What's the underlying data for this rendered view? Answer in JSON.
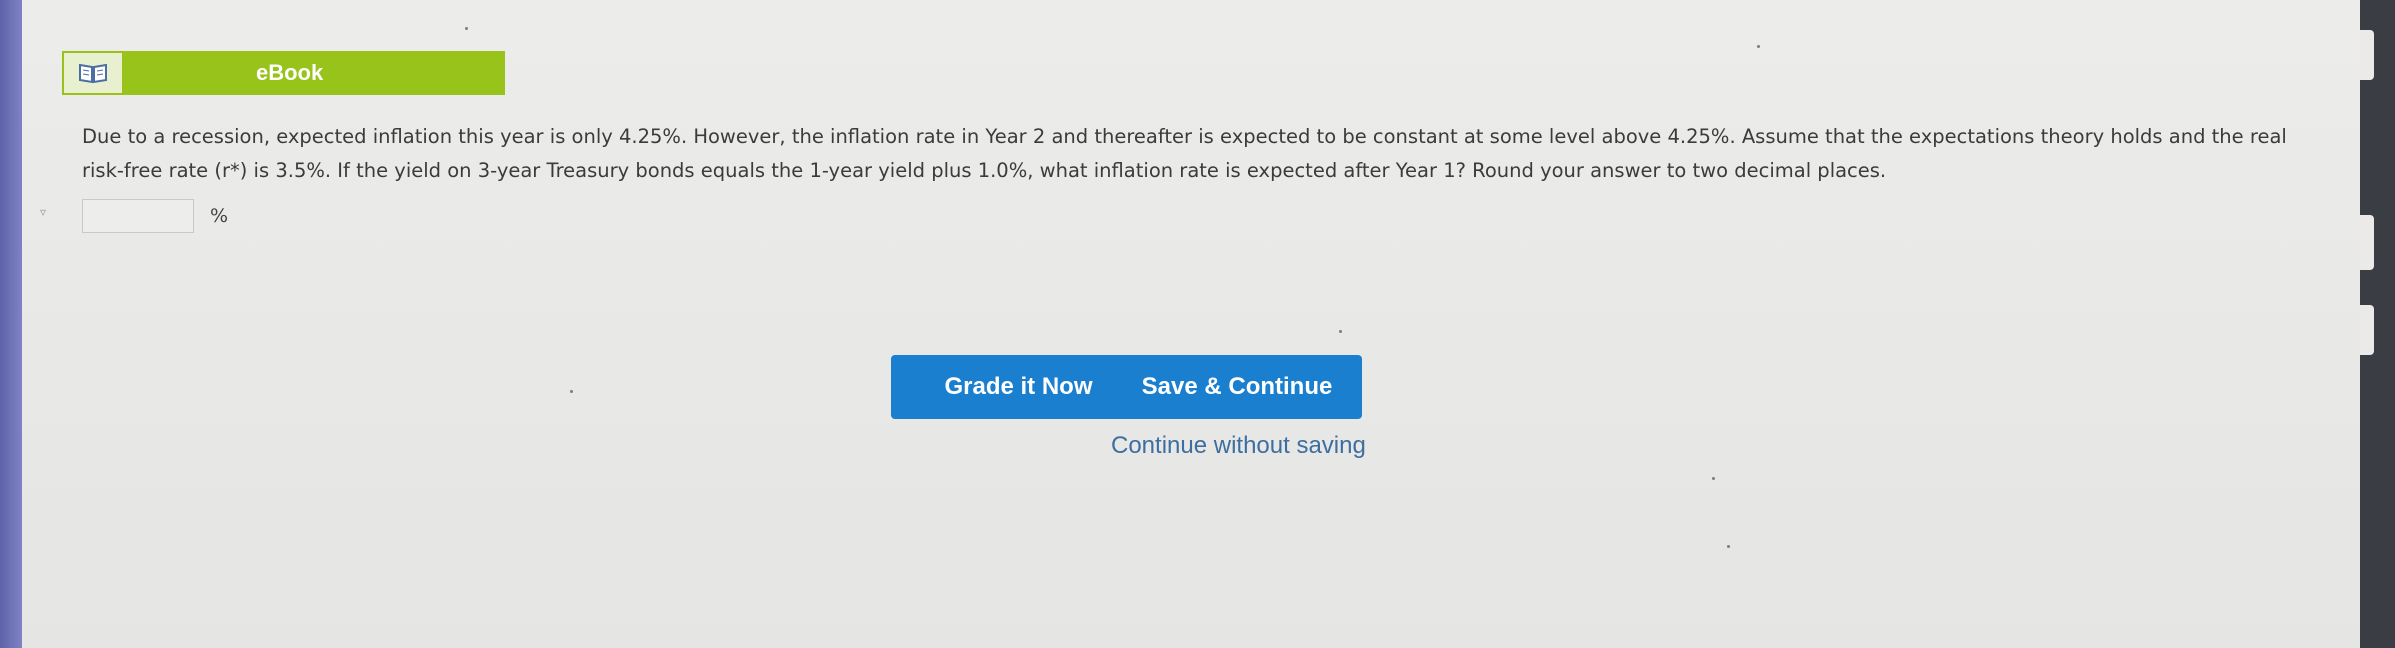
{
  "ebook": {
    "icon": "open-book-icon",
    "label": "eBook"
  },
  "question": {
    "text": "Due to a recession, expected inflation this year is only 4.25%. However, the inflation rate in Year 2 and thereafter is expected to be constant at some level above 4.25%. Assume that the expectations theory holds and the real risk-free rate (r*) is 3.5%. If the yield on 3-year Treasury bonds equals the 1-year yield plus 1.0%, what inflation rate is expected after Year 1? Round your answer to two decimal places."
  },
  "answer": {
    "value": "",
    "unit": "%"
  },
  "buttons": {
    "grade_label": "Grade it Now",
    "save_label": "Save & Continue",
    "continue_label": "Continue without saving"
  },
  "colors": {
    "ebook_green": "#97c31a",
    "button_blue": "#1b7fd0",
    "link_blue": "#3d6ea0",
    "text": "#3b3b3b"
  }
}
